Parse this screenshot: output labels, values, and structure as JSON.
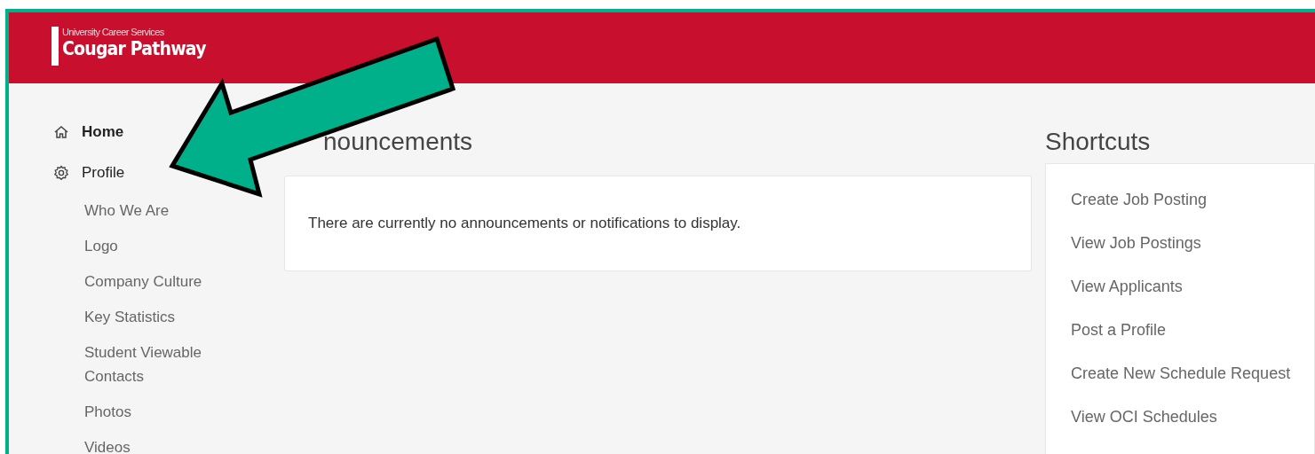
{
  "header": {
    "logo_subtitle": "University Career Services",
    "logo_title": "Cougar Pathway"
  },
  "sidebar": {
    "items": [
      {
        "label": "Home"
      },
      {
        "label": "Profile",
        "children": [
          {
            "label": "Who We Are"
          },
          {
            "label": "Logo"
          },
          {
            "label": "Company Culture"
          },
          {
            "label": "Key Statistics"
          },
          {
            "label": "Student Viewable Contacts"
          },
          {
            "label": "Photos"
          },
          {
            "label": "Videos"
          }
        ]
      }
    ]
  },
  "announcements": {
    "heading": "nouncements",
    "message": "There are currently no announcements or notifications to display."
  },
  "shortcuts": {
    "heading": "Shortcuts",
    "items": [
      "Create Job Posting",
      "View Job Postings",
      "View Applicants",
      "Post a Profile",
      "Create New Schedule Request",
      "View OCI Schedules"
    ]
  }
}
